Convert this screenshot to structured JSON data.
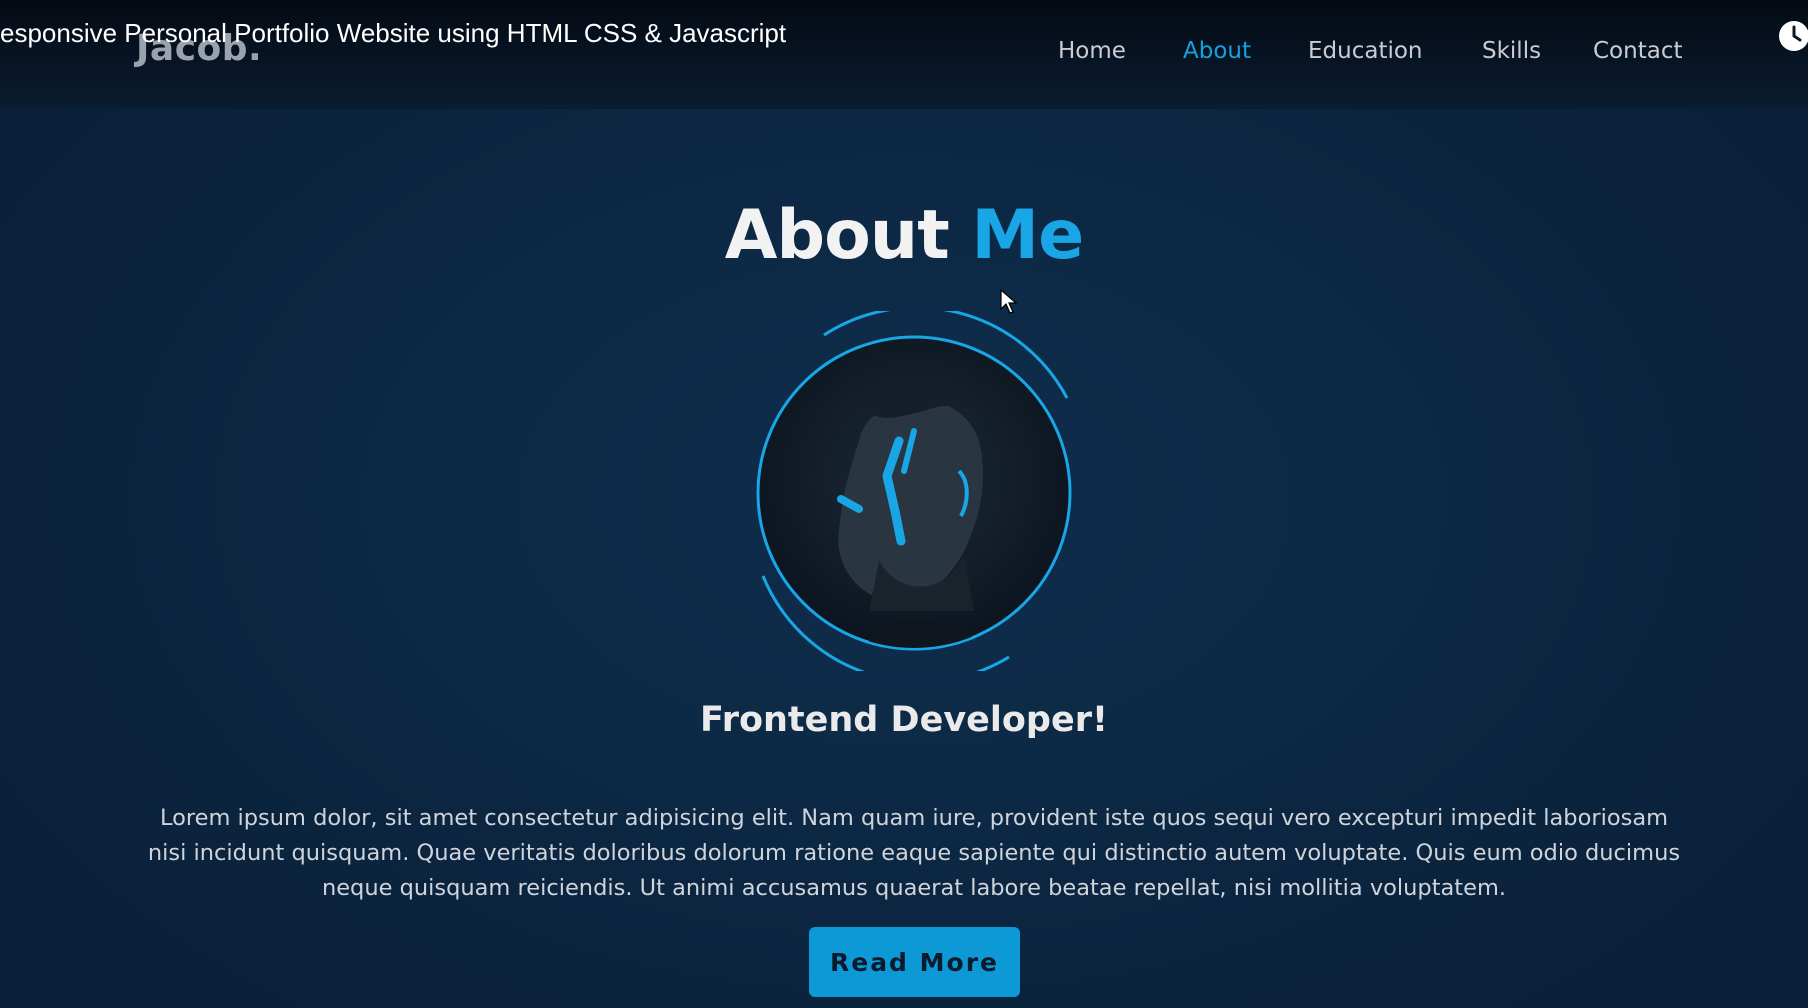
{
  "video_title": "esponsive Personal Portfolio Website using HTML CSS & Javascript",
  "header": {
    "logo": "Jacob.",
    "nav": [
      {
        "label": "Home"
      },
      {
        "label": "About"
      },
      {
        "label": "Education"
      },
      {
        "label": "Skills"
      },
      {
        "label": "Contact"
      }
    ],
    "active_nav": "About"
  },
  "about": {
    "title_main": "About",
    "title_accent": "Me",
    "role": "Frontend Developer!",
    "bio": "Lorem ipsum dolor, sit amet consectetur adipisicing elit. Nam quam iure, provident iste quos sequi vero excepturi impedit laboriosam nisi incidunt quisquam. Quae veritatis doloribus dolorum ratione eaque sapiente qui distinctio autem voluptate. Quis eum odio ducimus neque quisquam reiciendis. Ut animi accusamus quaerat labore beatae repellat, nisi mollitia voluptatem.",
    "button_label": "Read More"
  },
  "colors": {
    "accent": "#18a6e6",
    "background": "#0c2540",
    "header": "#071424",
    "button": "#0c99d6"
  },
  "icons": {
    "clock": "clock-icon",
    "cursor": "mouse-pointer-icon"
  }
}
